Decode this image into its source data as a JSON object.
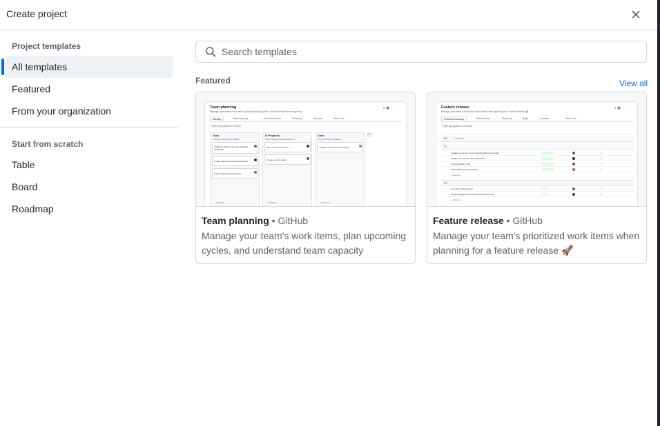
{
  "dialog": {
    "title": "Create project",
    "close_icon": "close-icon"
  },
  "sidebar": {
    "templates_heading": "Project templates",
    "template_items": [
      {
        "label": "All templates",
        "active": true
      },
      {
        "label": "Featured",
        "active": false
      },
      {
        "label": "From your organization",
        "active": false
      }
    ],
    "scratch_heading": "Start from scratch",
    "scratch_items": [
      {
        "label": "Table"
      },
      {
        "label": "Board"
      },
      {
        "label": "Roadmap"
      }
    ]
  },
  "search": {
    "placeholder": "Search templates",
    "value": "",
    "icon": "search-icon"
  },
  "featured": {
    "label": "Featured",
    "view_all": "View all"
  },
  "cards": [
    {
      "name": "Team planning",
      "separator": "•",
      "owner": "GitHub",
      "description": "Manage your team's work items, plan upcoming cycles, and understand team capacity",
      "preview": {
        "title": "Team planning",
        "subtitle": "Manage your team's work items, plan upcoming cycles, and understand team capacity.",
        "tabs": [
          "Backlog",
          "Team capacity",
          "Current iteration",
          "Roadmap",
          "My items",
          "+ New view"
        ],
        "filter": "Filter by keyword or by field",
        "columns": [
          {
            "name": "Todo",
            "note": "This item hasn't been started",
            "cards": [
              "Update to reflect of the plan activities documents",
              "Create user account and subscription",
              "Add a leaderboard for Europe"
            ]
          },
          {
            "name": "In Progress",
            "note": "This is actively being worked on",
            "cards": [
              "Best route across levels",
              "Create a quick model"
            ]
          },
          {
            "name": "Done",
            "note": "This has been completed",
            "cards": [
              "Integrate with Commerce Service"
            ]
          }
        ],
        "add_item": "+ Add item"
      }
    },
    {
      "name": "Feature release",
      "separator": "•",
      "owner": "GitHub",
      "description": "Manage your team's prioritized work items when planning for a feature release 🚀",
      "preview": {
        "title": "Feature release",
        "subtitle": "Manage your team's prioritized work items when planning for a feature release 🚀",
        "tabs": [
          "Prioritized backlog",
          "Status board",
          "Roadmap",
          "Bugs",
          "In review",
          "+ New view"
        ],
        "filter": "Filter by keyword or by field",
        "groups": [
          {
            "name": "P0",
            "rows": [
              "Release 1"
            ]
          },
          {
            "name": "P1",
            "rows": [
              "Updates to velocity of the ship and other movements",
              "Create user account and subscription",
              "Improve github mode",
              "Add a leaderboard for Europe"
            ]
          },
          {
            "name": "P2",
            "rows": [
              "Look done across boost",
              "Review engagement metrics and results to use"
            ]
          }
        ],
        "add_item": "+ Add item"
      }
    }
  ],
  "colors": {
    "accent": "#0969da",
    "active_bg": "#eff2f5",
    "border": "#d0d7de",
    "muted_text": "#59636e"
  }
}
